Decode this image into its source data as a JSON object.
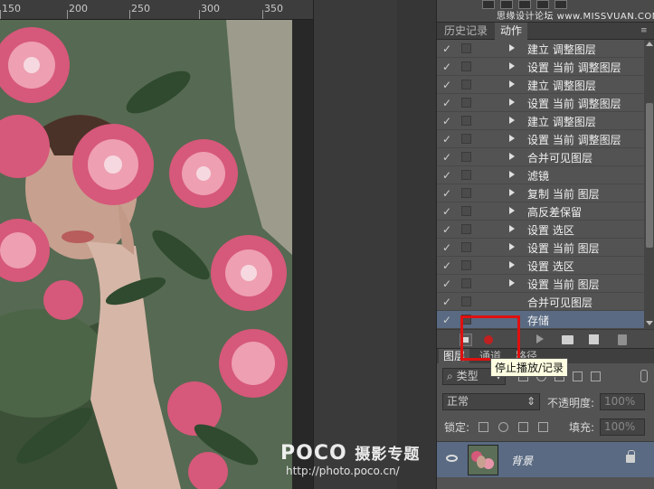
{
  "ruler": {
    "labels": [
      "150",
      "200",
      "250",
      "300",
      "350"
    ]
  },
  "top_strip": {
    "watermark": "思缘设计论坛 www.MISSVUAN.COM"
  },
  "tabs": [
    {
      "label": "历史记录",
      "active": false
    },
    {
      "label": "动作",
      "active": true
    }
  ],
  "actions": {
    "rows": [
      {
        "label": "建立 调整图层",
        "expandable": true,
        "checked": true,
        "selected": false
      },
      {
        "label": "设置 当前 调整图层",
        "expandable": true,
        "checked": true,
        "selected": false
      },
      {
        "label": "建立 调整图层",
        "expandable": true,
        "checked": true,
        "selected": false
      },
      {
        "label": "设置 当前 调整图层",
        "expandable": true,
        "checked": true,
        "selected": false
      },
      {
        "label": "建立 调整图层",
        "expandable": true,
        "checked": true,
        "selected": false
      },
      {
        "label": "设置 当前 调整图层",
        "expandable": true,
        "checked": true,
        "selected": false
      },
      {
        "label": "合并可见图层",
        "expandable": true,
        "checked": true,
        "selected": false
      },
      {
        "label": "滤镜",
        "expandable": true,
        "checked": true,
        "selected": false
      },
      {
        "label": "复制 当前 图层",
        "expandable": true,
        "checked": true,
        "selected": false
      },
      {
        "label": "高反差保留",
        "expandable": true,
        "checked": true,
        "selected": false
      },
      {
        "label": "设置 选区",
        "expandable": true,
        "checked": true,
        "selected": false
      },
      {
        "label": "设置 当前 图层",
        "expandable": true,
        "checked": true,
        "selected": false
      },
      {
        "label": "设置 选区",
        "expandable": true,
        "checked": true,
        "selected": false
      },
      {
        "label": "设置 当前 图层",
        "expandable": true,
        "checked": true,
        "selected": false
      },
      {
        "label": "合并可见图层",
        "expandable": false,
        "checked": true,
        "selected": false
      },
      {
        "label": "存储",
        "expandable": false,
        "checked": true,
        "selected": true
      }
    ]
  },
  "toolbar": {
    "tooltip": "停止播放/记录",
    "icons": [
      "stop-icon",
      "record-icon",
      "play-icon",
      "folder-icon",
      "new-action-icon",
      "trash-icon"
    ]
  },
  "layers": {
    "tabs": [
      "图层",
      "通道",
      "路径"
    ],
    "filter_label": "类型",
    "blend_mode": "正常",
    "opacity_label": "不透明度:",
    "opacity_value": "100%",
    "lock_label": "锁定:",
    "fill_label": "填充:",
    "fill_value": "100%",
    "layer_name": "背景"
  },
  "watermark_bottom": {
    "logo": "POCO",
    "logo_suffix": "摄影专题",
    "url": "http://photo.poco.cn/"
  },
  "colors": {
    "panel_bg": "#535353",
    "selected_row": "#596a82",
    "highlight_red": "#e01010",
    "tooltip_bg": "#ffffe1"
  }
}
